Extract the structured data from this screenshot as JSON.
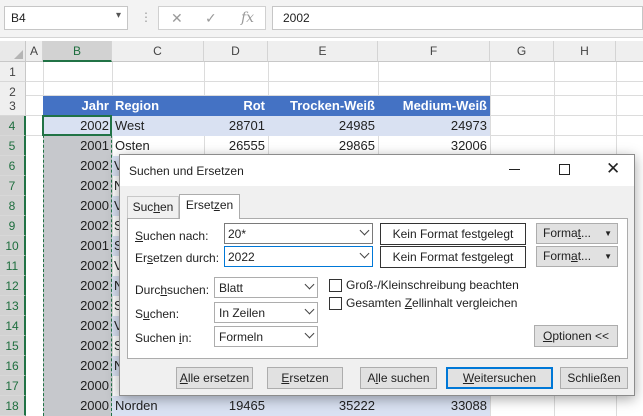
{
  "formula_bar": {
    "name_box": "B4",
    "name_box_icon": "chevron-down-icon",
    "dots": "⋮",
    "cancel_glyph": "✕",
    "enter_glyph": "✓",
    "fx_glyph": "fx",
    "value": "2002"
  },
  "columns": [
    "A",
    "B",
    "C",
    "D",
    "E",
    "F",
    "G",
    "H"
  ],
  "rows": [
    "1",
    "2",
    "3",
    "4",
    "5",
    "6",
    "7",
    "8",
    "9",
    "10",
    "11",
    "12",
    "13",
    "14",
    "15",
    "16",
    "17",
    "18"
  ],
  "table": {
    "headers": [
      "Jahr",
      "Region",
      "Rot",
      "Trocken-Weiß",
      "Medium-Weiß"
    ],
    "row4": [
      "2002",
      "West",
      "28701",
      "24985",
      "24973"
    ],
    "row5": [
      "2001",
      "Osten",
      "26555",
      "29865",
      "32006"
    ],
    "years_col_b": [
      "2002",
      "2002",
      "2000",
      "2002",
      "2001",
      "2002",
      "2002",
      "2002",
      "2002",
      "2002",
      "2002",
      "2000"
    ],
    "region_initials": [
      "V",
      "N",
      "V",
      "S",
      "S",
      "V",
      "N",
      "S",
      "V",
      "S",
      "N"
    ],
    "last_row": [
      "2000",
      "Norden",
      "19465",
      "35222",
      "33088"
    ]
  },
  "dialog": {
    "title": "Suchen und Ersetzen",
    "tabs": [
      {
        "pre": "Suc",
        "ul": "h",
        "post": "en"
      },
      {
        "pre": "Erset",
        "ul": "z",
        "post": "en"
      }
    ],
    "find_label": {
      "pre": "",
      "ul": "S",
      "post": "uchen nach:"
    },
    "find_value": "20*",
    "replace_label": {
      "pre": "Er",
      "ul": "s",
      "post": "etzen durch:"
    },
    "replace_value": "2022",
    "no_format_1": "Kein Format festgelegt",
    "no_format_2": "Kein Format festgelegt",
    "format_btn_1": {
      "pre": "Forma",
      "ul": "t",
      "post": "..."
    },
    "format_btn_2": {
      "pre": "Form",
      "ul": "a",
      "post": "t..."
    },
    "within_label": {
      "pre": "Durc",
      "ul": "h",
      "post": "suchen:"
    },
    "within_value": "Blatt",
    "search_label": {
      "pre": "S",
      "ul": "u",
      "post": "chen:"
    },
    "search_value": "In Zeilen",
    "lookin_label": {
      "pre": "Suchen ",
      "ul": "i",
      "post": "n:"
    },
    "lookin_value": "Formeln",
    "match_case": {
      "pre": "Groß-/Kleinschreibung beachten",
      "ul": "",
      "post": ""
    },
    "match_entire": {
      "pre": "Gesamten ",
      "ul": "Z",
      "post": "ellinhalt vergleichen"
    },
    "options_btn": {
      "pre": "",
      "ul": "O",
      "post": "ptionen <<"
    },
    "buttons": {
      "replace_all": {
        "pre": "",
        "ul": "A",
        "post": "lle ersetzen"
      },
      "replace": {
        "pre": "",
        "ul": "E",
        "post": "rsetzen"
      },
      "find_all": {
        "pre": "A",
        "ul": "l",
        "post": "le suchen"
      },
      "find_next": {
        "pre": "",
        "ul": "W",
        "post": "eitersuchen"
      },
      "close": "Schließen"
    }
  }
}
